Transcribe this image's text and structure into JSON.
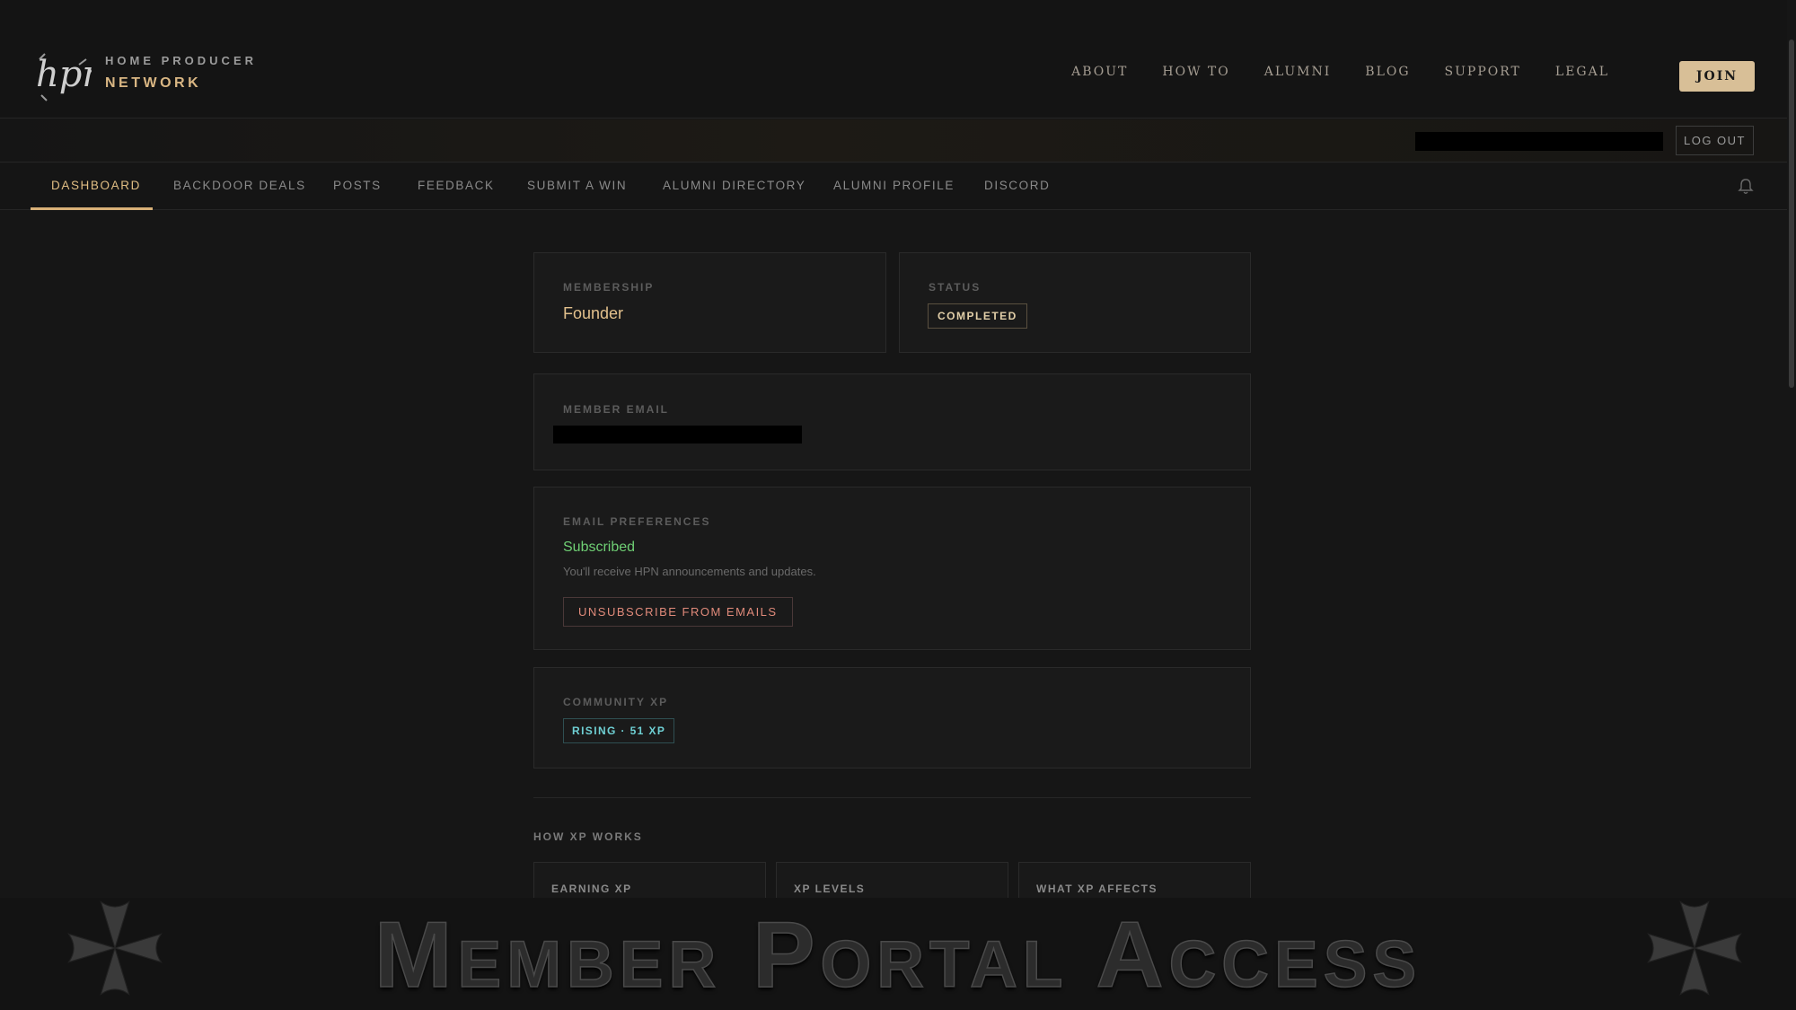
{
  "brand": {
    "logo_text": "hpn",
    "line1": "HOME PRODUCER",
    "line2": "NETWORK"
  },
  "topnav": {
    "items": [
      "ABOUT",
      "HOW TO",
      "ALUMNI",
      "BLOG",
      "SUPPORT",
      "LEGAL"
    ],
    "join_label": "JOIN"
  },
  "subbar": {
    "logout_label": "LOG OUT"
  },
  "tabs": {
    "items": [
      "DASHBOARD",
      "BACKDOOR DEALS",
      "POSTS",
      "FEEDBACK",
      "SUBMIT A WIN",
      "ALUMNI DIRECTORY",
      "ALUMNI PROFILE",
      "DISCORD"
    ],
    "active": "DASHBOARD"
  },
  "membership": {
    "label": "MEMBERSHIP",
    "value": "Founder"
  },
  "status": {
    "label": "STATUS",
    "value": "COMPLETED"
  },
  "member_email": {
    "label": "MEMBER EMAIL"
  },
  "email_prefs": {
    "label": "EMAIL PREFERENCES",
    "state": "Subscribed",
    "description": "You'll receive HPN announcements and updates.",
    "unsubscribe_label": "UNSUBSCRIBE FROM EMAILS"
  },
  "community_xp": {
    "label": "COMMUNITY XP",
    "badge": "RISING · 51 XP"
  },
  "how_xp": {
    "title": "HOW XP WORKS",
    "cards": [
      "EARNING XP",
      "XP LEVELS",
      "WHAT XP AFFECTS"
    ]
  },
  "banner": {
    "text": "Member Portal Access"
  },
  "colors": {
    "accent_gold": "#d8b078",
    "subscribed_green": "#6fcf74",
    "unsubscribe_red": "#e08a7a",
    "xp_teal": "#6fd0d4"
  },
  "icons": {
    "notifications": "bell-icon",
    "banner_ornament": "cross-pattee-icon"
  }
}
